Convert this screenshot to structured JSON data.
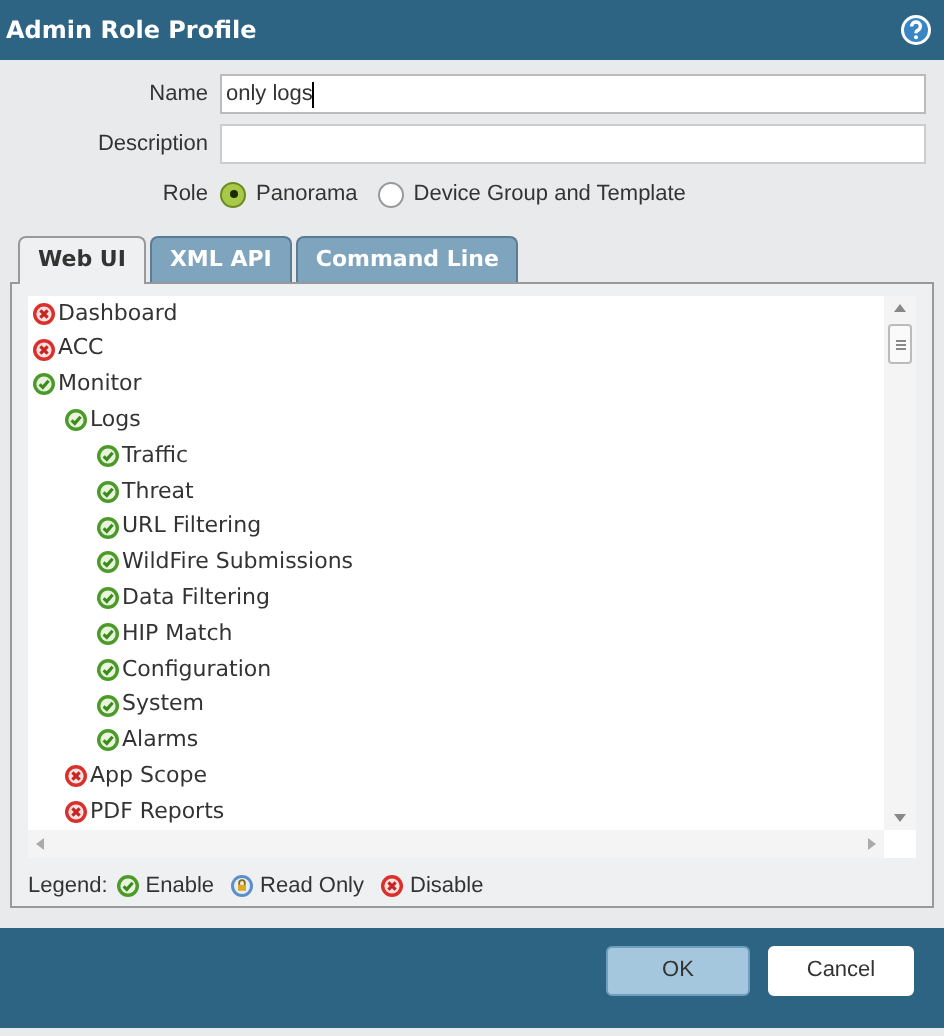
{
  "window": {
    "title": "Admin Role Profile"
  },
  "form": {
    "name_label": "Name",
    "name_value": "only logs",
    "description_label": "Description",
    "role_label": "Role",
    "role_options": [
      {
        "label": "Panorama",
        "selected": true
      },
      {
        "label": "Device Group and Template",
        "selected": false
      }
    ]
  },
  "tabs": [
    {
      "label": "Web UI",
      "selected": true
    },
    {
      "label": "XML API",
      "selected": false
    },
    {
      "label": "Command Line",
      "selected": false
    }
  ],
  "tree": [
    {
      "label": "Dashboard",
      "kind": "disable"
    },
    {
      "label": "ACC",
      "kind": "disable"
    },
    {
      "label": "Monitor",
      "kind": "enable",
      "children": [
        {
          "label": "Logs",
          "kind": "enable",
          "children": [
            {
              "label": "Traffic",
              "kind": "enable"
            },
            {
              "label": "Threat",
              "kind": "enable"
            },
            {
              "label": "URL Filtering",
              "kind": "enable"
            },
            {
              "label": "WildFire Submissions",
              "kind": "enable"
            },
            {
              "label": "Data Filtering",
              "kind": "enable"
            },
            {
              "label": "HIP Match",
              "kind": "enable"
            },
            {
              "label": "Configuration",
              "kind": "enable"
            },
            {
              "label": "System",
              "kind": "enable"
            },
            {
              "label": "Alarms",
              "kind": "enable"
            }
          ]
        },
        {
          "label": "App Scope",
          "kind": "disable"
        },
        {
          "label": "PDF Reports",
          "kind": "disable"
        }
      ]
    }
  ],
  "legend": {
    "label": "Legend:",
    "items": [
      {
        "label": "Enable",
        "kind": "enable"
      },
      {
        "label": "Read Only",
        "kind": "read_only"
      },
      {
        "label": "Disable",
        "kind": "disable"
      }
    ]
  },
  "buttons": [
    {
      "label": "OK",
      "kind": "primary"
    },
    {
      "label": "Cancel",
      "kind": "secondary"
    }
  ]
}
